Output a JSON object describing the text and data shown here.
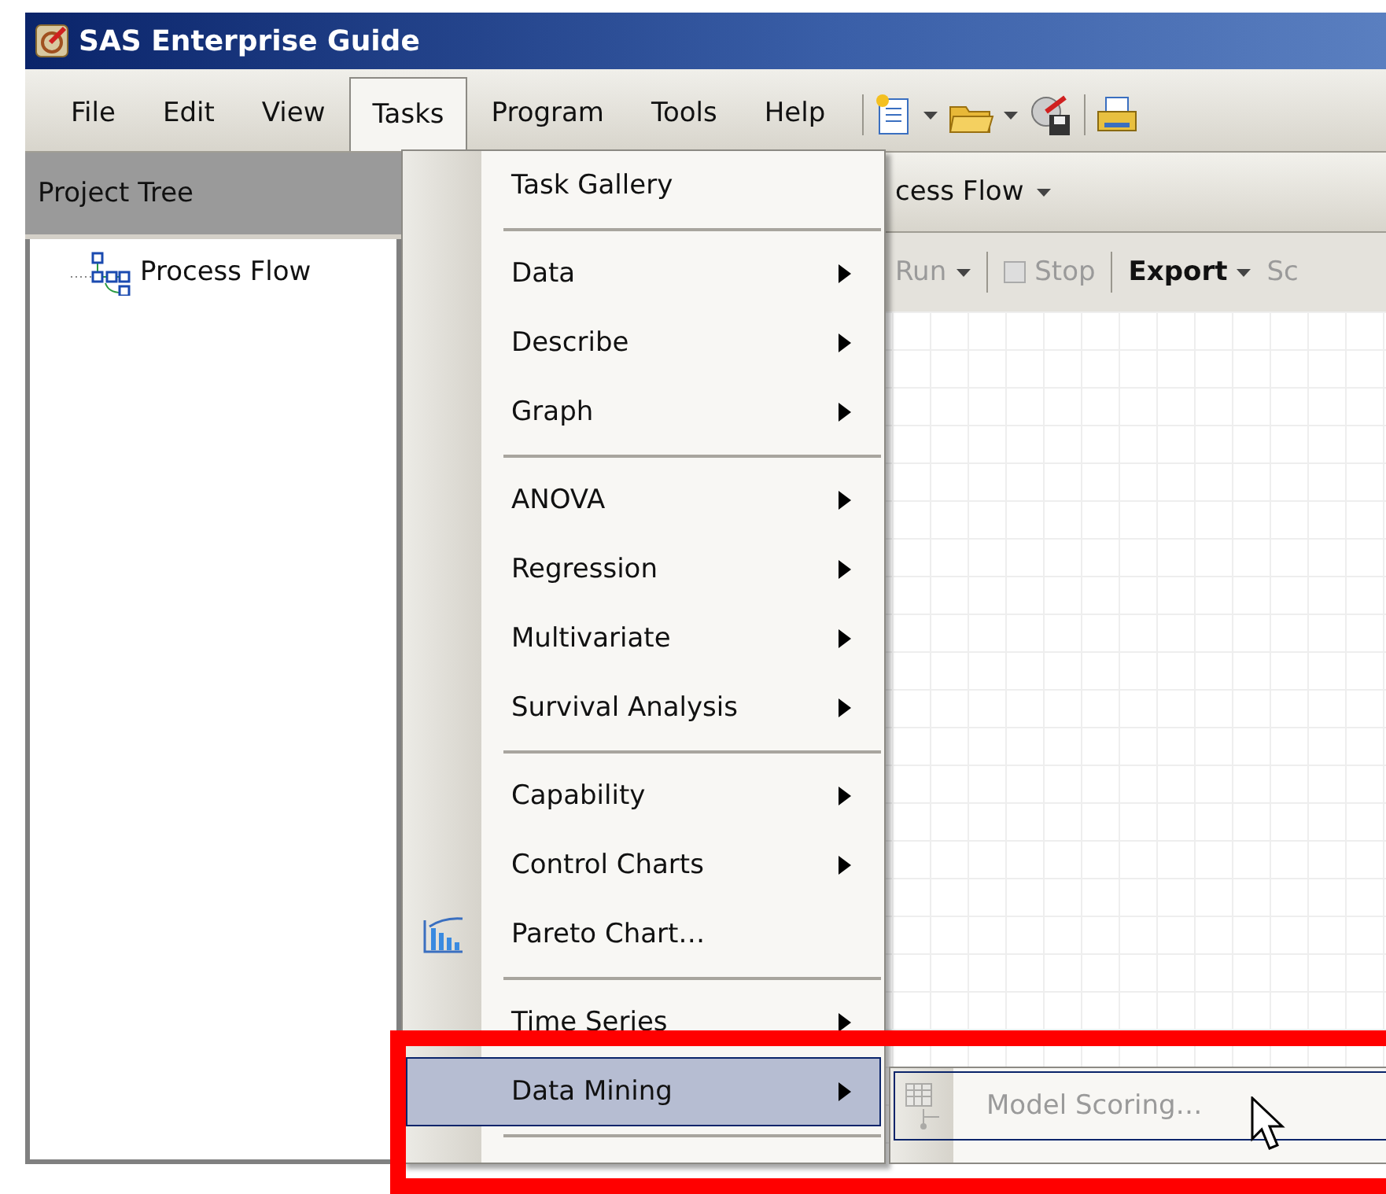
{
  "window": {
    "title": "SAS Enterprise Guide"
  },
  "menu_bar": [
    {
      "label": "File",
      "selected": false
    },
    {
      "label": "Edit",
      "selected": false
    },
    {
      "label": "View",
      "selected": false
    },
    {
      "label": "Tasks",
      "selected": true
    },
    {
      "label": "Program",
      "selected": false
    },
    {
      "label": "Tools",
      "selected": false
    },
    {
      "label": "Help",
      "selected": false
    }
  ],
  "project_tree": {
    "title": "Project Tree",
    "items": [
      {
        "label": "Process Flow"
      }
    ]
  },
  "flow_pane": {
    "title": "cess Flow",
    "toolbar": [
      {
        "kind": "dropdown",
        "label": "Run",
        "disabled": true
      },
      {
        "kind": "check",
        "label": "Stop",
        "disabled": true
      },
      {
        "kind": "dropdown",
        "label": "Export",
        "disabled": false
      },
      {
        "kind": "text",
        "label": "Sc",
        "disabled": true
      }
    ]
  },
  "tasks_menu": [
    {
      "kind": "item",
      "label": "Task Gallery",
      "submenu": false,
      "icon": false,
      "selected": false
    },
    {
      "kind": "separator"
    },
    {
      "kind": "item",
      "label": "Data",
      "submenu": true,
      "icon": false,
      "selected": false
    },
    {
      "kind": "item",
      "label": "Describe",
      "submenu": true,
      "icon": false,
      "selected": false
    },
    {
      "kind": "item",
      "label": "Graph",
      "submenu": true,
      "icon": false,
      "selected": false
    },
    {
      "kind": "separator"
    },
    {
      "kind": "item",
      "label": "ANOVA",
      "submenu": true,
      "icon": false,
      "selected": false
    },
    {
      "kind": "item",
      "label": "Regression",
      "submenu": true,
      "icon": false,
      "selected": false
    },
    {
      "kind": "item",
      "label": "Multivariate",
      "submenu": true,
      "icon": false,
      "selected": false
    },
    {
      "kind": "item",
      "label": "Survival Analysis",
      "submenu": true,
      "icon": false,
      "selected": false
    },
    {
      "kind": "separator"
    },
    {
      "kind": "item",
      "label": "Capability",
      "submenu": true,
      "icon": false,
      "selected": false
    },
    {
      "kind": "item",
      "label": "Control Charts",
      "submenu": true,
      "icon": false,
      "selected": false
    },
    {
      "kind": "item",
      "label": "Pareto Chart…",
      "submenu": false,
      "icon": true,
      "selected": false
    },
    {
      "kind": "separator"
    },
    {
      "kind": "item",
      "label": "Time Series",
      "submenu": true,
      "icon": false,
      "selected": false
    },
    {
      "kind": "item",
      "label": "Data Mining",
      "submenu": true,
      "icon": false,
      "selected": true
    },
    {
      "kind": "separator"
    }
  ],
  "submenu": [
    {
      "label": "Model Scoring…",
      "disabled": true,
      "selected": true
    }
  ]
}
